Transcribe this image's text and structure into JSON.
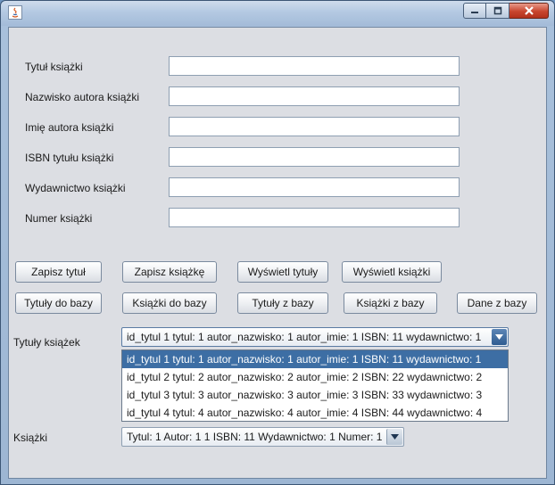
{
  "window": {
    "title": ""
  },
  "form": {
    "fields": [
      {
        "label": "Tytuł książki",
        "value": ""
      },
      {
        "label": "Nazwisko autora książki",
        "value": ""
      },
      {
        "label": "Imię autora książki",
        "value": ""
      },
      {
        "label": "ISBN tytułu książki",
        "value": ""
      },
      {
        "label": "Wydawnictwo książki",
        "value": ""
      },
      {
        "label": "Numer książki",
        "value": ""
      }
    ]
  },
  "buttons": {
    "row1": [
      "Zapisz tytuł",
      "Zapisz książkę",
      "Wyświetl tytuły",
      "Wyświetl książki"
    ],
    "row2": [
      "Tytuły do bazy",
      "Książki do bazy",
      "Tytuły z bazy",
      "Książki z bazy",
      "Dane z bazy"
    ]
  },
  "titles_combo": {
    "label": "Tytuły książek",
    "selected": "id_tytul 1 tytul: 1 autor_nazwisko: 1 autor_imie: 1 ISBN: 11 wydawnictwo: 1",
    "options": [
      "id_tytul 1 tytul: 1 autor_nazwisko: 1 autor_imie: 1 ISBN: 11 wydawnictwo: 1",
      "id_tytul 2 tytul: 2 autor_nazwisko: 2 autor_imie: 2 ISBN: 22 wydawnictwo: 2",
      "id_tytul 3 tytul: 3 autor_nazwisko: 3 autor_imie: 3 ISBN: 33 wydawnictwo: 3",
      "id_tytul 4 tytul: 4 autor_nazwisko: 4 autor_imie: 4 ISBN: 44 wydawnictwo: 4"
    ],
    "expanded": true,
    "highlighted_index": 0
  },
  "books_combo": {
    "label": "Książki",
    "selected": "Tytul: 1 Autor: 1 1 ISBN: 11 Wydawnictwo: 1 Numer: 1"
  },
  "colors": {
    "selection": "#3d6ea4",
    "panel": "#dcdee3",
    "close_button": "#c8452e"
  },
  "icons": {
    "app": "java-app-icon",
    "minimize": "minimize-icon",
    "maximize": "maximize-icon",
    "close": "close-icon",
    "dropdown": "chevron-down-icon"
  }
}
